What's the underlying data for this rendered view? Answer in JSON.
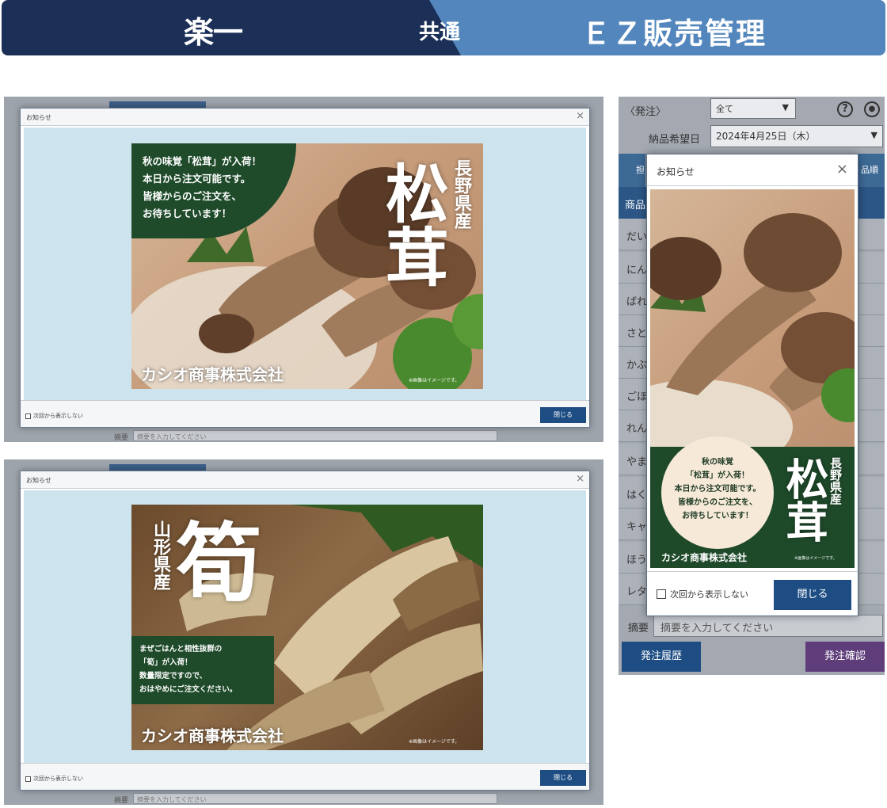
{
  "banner": {
    "logo": "楽一",
    "common": "共通",
    "product": "ＥＺ販売管理"
  },
  "desktop_dialog_1": {
    "title": "お知らせ",
    "close_icon": "×",
    "checkbox_label": "次回から表示しない",
    "close_button": "閉じる",
    "summary_label": "摘要",
    "summary_placeholder": "摘要を入力してください",
    "poster": {
      "message_lines": [
        "秋の味覚「松茸」が入荷！",
        "本日から注文可能です。",
        "皆様からのご注文を、",
        "お待ちしています！"
      ],
      "origin": "長野県産",
      "product": "松茸",
      "company": "カシオ商事株式会社",
      "note": "※画像はイメージです。"
    }
  },
  "desktop_dialog_2": {
    "title": "お知らせ",
    "close_icon": "×",
    "checkbox_label": "次回から表示しない",
    "close_button": "閉じる",
    "summary_label": "摘要",
    "summary_placeholder": "摘要を入力してください",
    "poster": {
      "message_lines": [
        "まぜごはんと相性抜群の",
        "「筍」が入荷！",
        "数量限定ですので、",
        "おはやめにご注文ください。"
      ],
      "origin": "山形県産",
      "product": "筍",
      "company": "カシオ商事株式会社",
      "note": "※画像はイメージです。"
    }
  },
  "mobile": {
    "header_label": "〈発注〉",
    "filter_value": "全て",
    "help_icon": "?",
    "delivery_label": "納品希望日",
    "delivery_value": "2024年4月25日（木）",
    "tab_left": "担",
    "tab_right": "品順",
    "list_header": "商品",
    "list_items": [
      "だい",
      "にん",
      "ばれ",
      "さと",
      "かぶ",
      "ごほ",
      "れん",
      "やま",
      "はく",
      "キャ",
      "ほう",
      "レタ"
    ],
    "summary_label": "摘要",
    "summary_placeholder": "摘要を入力してください",
    "history_button": "発注履歴",
    "confirm_button": "発注確認",
    "dialog": {
      "title": "お知らせ",
      "close_icon": "×",
      "checkbox_label": "次回から表示しない",
      "close_button": "閉じる",
      "poster": {
        "message_lines": [
          "秋の味覚",
          "「松茸」が入荷！",
          "本日から注文可能です。",
          "皆様からのご注文を、",
          "お待ちしています！"
        ],
        "origin": "長野県産",
        "product": "松茸",
        "company": "カシオ商事株式会社",
        "note": "※画像はイメージです。"
      }
    }
  },
  "colors": {
    "banner_dark": "#1b2f57",
    "banner_light": "#5286bc",
    "primary_button": "#1d4d83",
    "confirm_button": "#5e3d7a",
    "poster_green": "#1f4b2b"
  }
}
